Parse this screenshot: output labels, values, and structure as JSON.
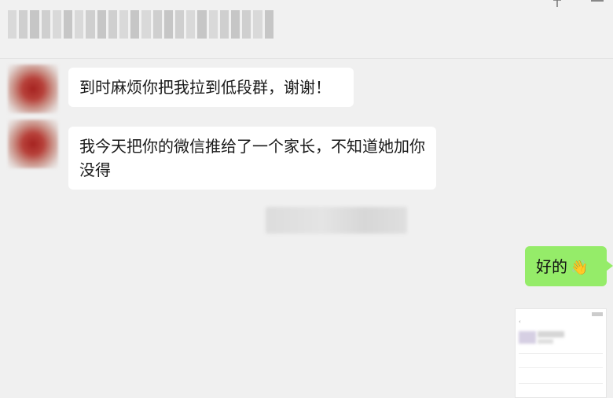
{
  "header": {
    "title": "",
    "title_blurred": true,
    "icons": [
      "pin-icon",
      "minimize-icon"
    ]
  },
  "messages": [
    {
      "sender": "other",
      "avatar": "blurred-avatar",
      "text": "到时麻烦你把我拉到低段群，谢谢！"
    },
    {
      "sender": "other",
      "avatar": "blurred-avatar",
      "text": "我今天把你的微信推给了一个家长，不知道她加你没得"
    },
    {
      "sender": "me",
      "text": "好的",
      "emoji": "👋"
    },
    {
      "sender": "me",
      "type": "image",
      "image": "phone-screenshot-thumbnail"
    }
  ],
  "colors": {
    "background": "#f0f0f0",
    "incoming_bubble": "#ffffff",
    "outgoing_bubble": "#95ec69"
  }
}
